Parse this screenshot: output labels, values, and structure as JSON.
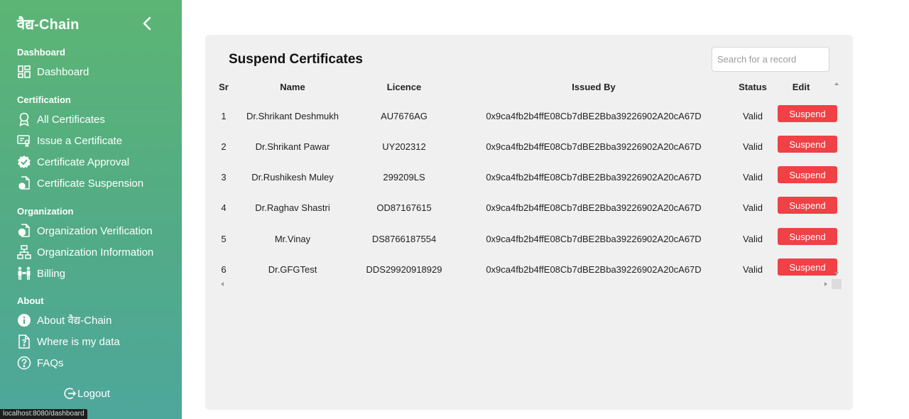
{
  "sidebar": {
    "brand": "वैद्य-Chain",
    "sections": {
      "dashboard": "Dashboard",
      "certification": "Certification",
      "organization": "Organization",
      "about": "About"
    },
    "items": [
      {
        "label": "Dashboard",
        "icon": "dashboard-icon"
      },
      {
        "label": "All Certificates",
        "icon": "award-icon"
      },
      {
        "label": "Issue a Certificate",
        "icon": "certificate-issue-icon"
      },
      {
        "label": "Certificate Approval",
        "icon": "badge-check-icon"
      },
      {
        "label": "Certificate Suspension",
        "icon": "document-suspend-icon"
      },
      {
        "label": "Organization Verification",
        "icon": "document-verify-icon"
      },
      {
        "label": "Organization Information",
        "icon": "hierarchy-icon"
      },
      {
        "label": "Billing",
        "icon": "people-money-icon"
      },
      {
        "label": "About वैद्य-Chain",
        "icon": "info-icon"
      },
      {
        "label": "Where is my data",
        "icon": "file-question-icon"
      },
      {
        "label": "FAQs",
        "icon": "question-icon"
      }
    ],
    "logout": "Logout"
  },
  "status_url": "localhost:8080/dashboard",
  "main": {
    "title": "Suspend Certificates",
    "search_placeholder": "Search for a record",
    "columns": [
      "Sr",
      "Name",
      "Licence",
      "Issued By",
      "Status",
      "Edit"
    ],
    "action_label": "Suspend",
    "rows": [
      {
        "sr": "1",
        "name": "Dr.Shrikant Deshmukh",
        "licence": "AU7676AG",
        "issued_by": "0x9ca4fb2b4ffE08Cb7dBE2Bba39226902A20cA67D",
        "status": "Valid"
      },
      {
        "sr": "2",
        "name": "Dr.Shrikant Pawar",
        "licence": "UY202312",
        "issued_by": "0x9ca4fb2b4ffE08Cb7dBE2Bba39226902A20cA67D",
        "status": "Valid"
      },
      {
        "sr": "3",
        "name": "Dr.Rushikesh Muley",
        "licence": "299209LS",
        "issued_by": "0x9ca4fb2b4ffE08Cb7dBE2Bba39226902A20cA67D",
        "status": "Valid"
      },
      {
        "sr": "4",
        "name": "Dr.Raghav Shastri",
        "licence": "OD87167615",
        "issued_by": "0x9ca4fb2b4ffE08Cb7dBE2Bba39226902A20cA67D",
        "status": "Valid"
      },
      {
        "sr": "5",
        "name": "Mr.Vinay",
        "licence": "DS8766187554",
        "issued_by": "0x9ca4fb2b4ffE08Cb7dBE2Bba39226902A20cA67D",
        "status": "Valid"
      },
      {
        "sr": "6",
        "name": "Dr.GFGTest",
        "licence": "DDS29920918929",
        "issued_by": "0x9ca4fb2b4ffE08Cb7dBE2Bba39226902A20cA67D",
        "status": "Valid"
      }
    ]
  },
  "colors": {
    "sidebar_top": "#5cb574",
    "sidebar_bottom": "#4ea79b",
    "card_bg": "#f0f0f0",
    "suspend_button": "#ef4146"
  }
}
